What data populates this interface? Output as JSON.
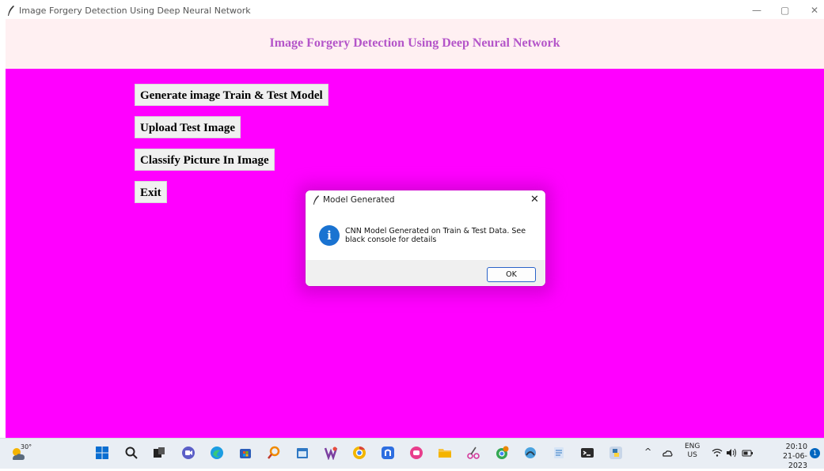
{
  "window": {
    "title": "Image Forgery Detection Using Deep Neural Network",
    "min_glyph": "—",
    "max_glyph": "▢",
    "close_glyph": "✕"
  },
  "app": {
    "heading": "Image Forgery Detection Using Deep Neural Network",
    "heading_color": "#b455c9",
    "background_color": "#ff00ff",
    "buttons": [
      {
        "label": "Generate image Train & Test Model"
      },
      {
        "label": "Upload Test Image"
      },
      {
        "label": "Classify Picture In Image"
      },
      {
        "label": "Exit"
      }
    ]
  },
  "dialog": {
    "title": "Model Generated",
    "close_glyph": "✕",
    "icon": "info-icon",
    "icon_glyph": "i",
    "message": "CNN Model Generated on Train & Test Data. See black console for details",
    "ok_label": "OK"
  },
  "taskbar": {
    "temperature": "30°",
    "icons": [
      "start-icon",
      "search-icon",
      "task-view-icon",
      "chat-icon",
      "edge-icon",
      "store-icon",
      "search-app-icon",
      "calendar-icon",
      "winrar-icon",
      "chrome-icon",
      "app-icon",
      "app2-icon",
      "file-explorer-icon",
      "snipping-tool-icon",
      "chrome-profile-icon",
      "app3-icon",
      "notepad-icon",
      "terminal-icon",
      "python-icon"
    ],
    "tray_chevron": "^",
    "language": "ENG",
    "region": "US",
    "time": "20:10",
    "date": "21-06-2023",
    "notification_count": "1"
  }
}
